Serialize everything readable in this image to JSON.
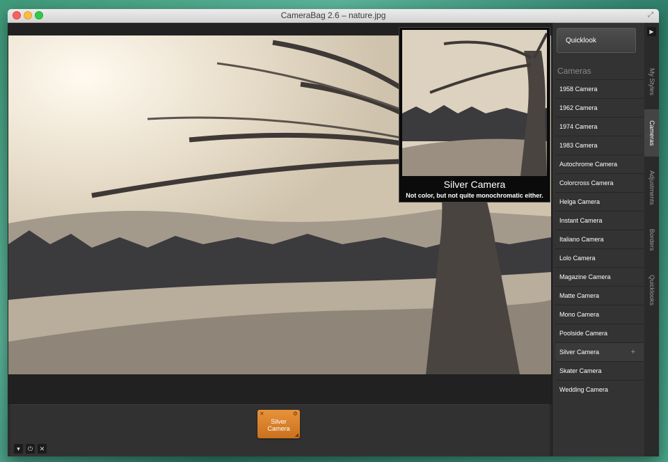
{
  "window": {
    "title": "CameraBag 2.6 – nature.jpg"
  },
  "preview": {
    "name": "Silver Camera",
    "description": "Not color, but not quite monochromatic either."
  },
  "sidebar": {
    "quicklook_label": "Quicklook",
    "heading": "Cameras",
    "items": [
      {
        "label": "1958 Camera"
      },
      {
        "label": "1962 Camera"
      },
      {
        "label": "1974 Camera"
      },
      {
        "label": "1983 Camera"
      },
      {
        "label": "Autochrome Camera"
      },
      {
        "label": "Colorcross Camera"
      },
      {
        "label": "Helga Camera"
      },
      {
        "label": "Instant Camera"
      },
      {
        "label": "Italiano Camera"
      },
      {
        "label": "Lolo Camera"
      },
      {
        "label": "Magazine Camera"
      },
      {
        "label": "Matte Camera"
      },
      {
        "label": "Mono Camera"
      },
      {
        "label": "Poolside Camera"
      },
      {
        "label": "Silver Camera",
        "add": "+"
      },
      {
        "label": "Skater Camera"
      },
      {
        "label": "Wedding Camera"
      }
    ]
  },
  "tabs": {
    "items": [
      {
        "label": "My Styles"
      },
      {
        "label": "Cameras"
      },
      {
        "label": "Adjustments"
      },
      {
        "label": "Borders"
      },
      {
        "label": "Quicklooks"
      }
    ],
    "active": "Cameras"
  },
  "tray": {
    "chip_label_line1": "Silver",
    "chip_label_line2": "Camera",
    "icons": [
      "menu-icon",
      "power-icon",
      "close-icon"
    ]
  },
  "colors": {
    "accent": "#e8923a",
    "sidebar_bg": "#333333",
    "photo_tone": "#d8cbb6"
  }
}
